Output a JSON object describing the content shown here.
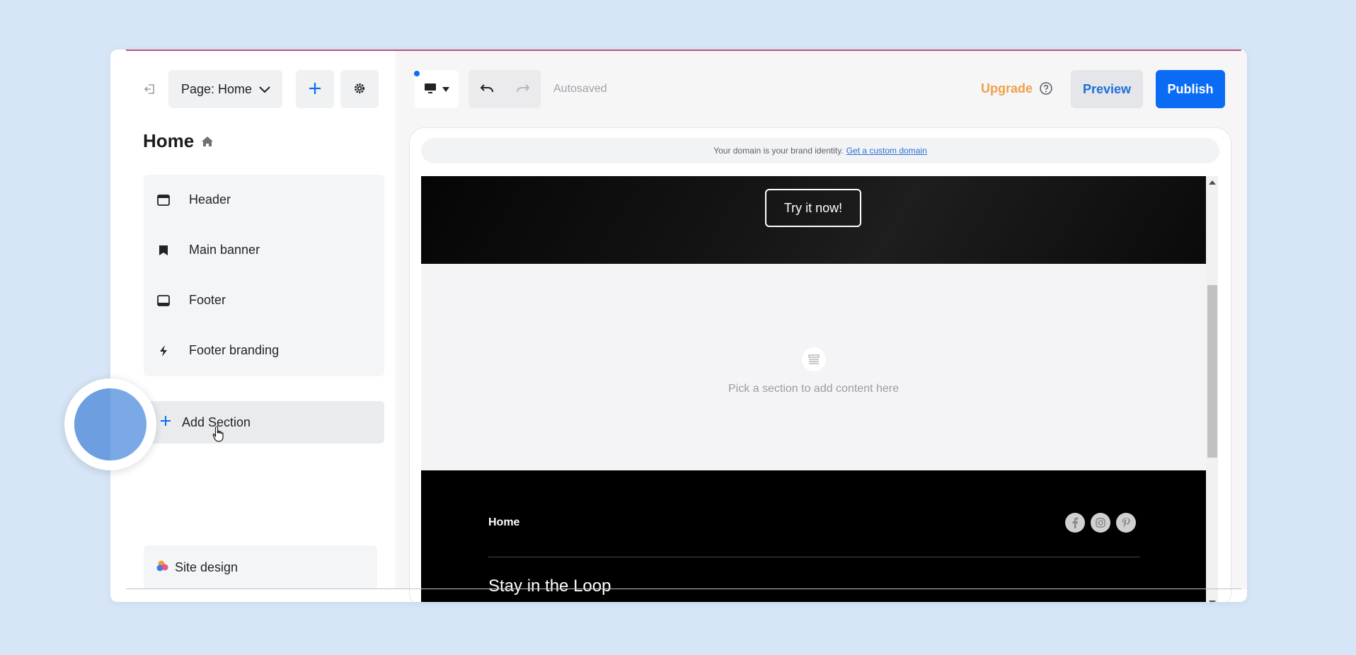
{
  "colors": {
    "accent": "#0a6cf5",
    "upgrade": "#f0a04b",
    "background": "#d6e6f7"
  },
  "sidebar": {
    "exit_icon": "exit-icon",
    "page_select_label": "Page: Home",
    "add_page_icon": "plus-icon",
    "settings_icon": "gear-icon",
    "page_title": "Home",
    "page_title_icon": "home-icon",
    "sections": [
      {
        "label": "Header",
        "icon": "header-icon"
      },
      {
        "label": "Main banner",
        "icon": "bookmark-icon"
      },
      {
        "label": "Footer",
        "icon": "footer-icon"
      },
      {
        "label": "Footer branding",
        "icon": "bolt-icon"
      }
    ],
    "add_section_label": "Add Section",
    "site_design_label": "Site design"
  },
  "toolbar": {
    "device_icon": "desktop-icon",
    "undo_icon": "undo-icon",
    "redo_icon": "redo-icon",
    "status": "Autosaved",
    "upgrade_label": "Upgrade",
    "help_icon": "help-icon",
    "preview_label": "Preview",
    "publish_label": "Publish"
  },
  "canvas": {
    "domain_text": "Your domain is your brand identity.",
    "domain_link": "Get a custom domain",
    "hero_button": "Try it now!",
    "empty_text": "Pick a section to add content here",
    "footer_home": "Home",
    "footer_heading": "Stay in the Loop",
    "socials": [
      "facebook-icon",
      "instagram-icon",
      "pinterest-icon"
    ]
  }
}
